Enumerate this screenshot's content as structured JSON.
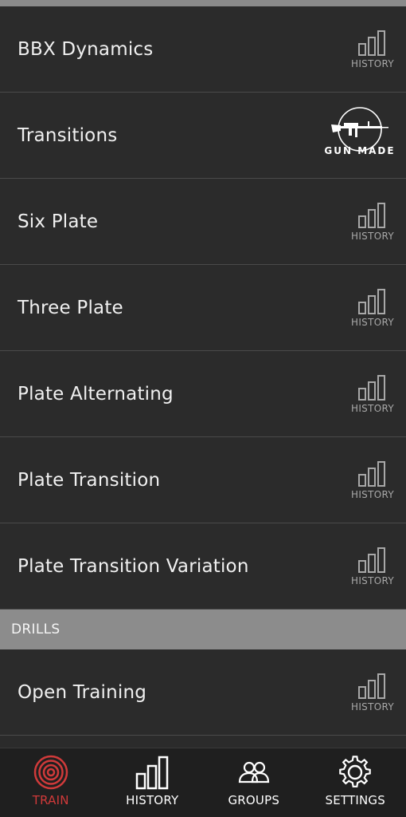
{
  "rows_top": [
    {
      "label": "BBX Dynamics",
      "action": "HISTORY"
    },
    {
      "label": "Transitions",
      "logo": "GUN MADE"
    },
    {
      "label": "Six Plate",
      "action": "HISTORY"
    },
    {
      "label": "Three Plate",
      "action": "HISTORY"
    },
    {
      "label": "Plate Alternating",
      "action": "HISTORY"
    },
    {
      "label": "Plate Transition",
      "action": "HISTORY"
    },
    {
      "label": "Plate Transition Variation",
      "action": "HISTORY"
    }
  ],
  "section": {
    "label": "DRILLS"
  },
  "rows_bottom": [
    {
      "label": "Open Training",
      "action": "HISTORY"
    }
  ],
  "nav": {
    "active_color": "#d03a3a",
    "tabs": [
      {
        "label": "TRAIN",
        "icon": "target-icon",
        "active": true
      },
      {
        "label": "HISTORY",
        "icon": "bar-chart-icon",
        "active": false
      },
      {
        "label": "GROUPS",
        "icon": "people-icon",
        "active": false
      },
      {
        "label": "SETTINGS",
        "icon": "gear-icon",
        "active": false
      }
    ]
  }
}
